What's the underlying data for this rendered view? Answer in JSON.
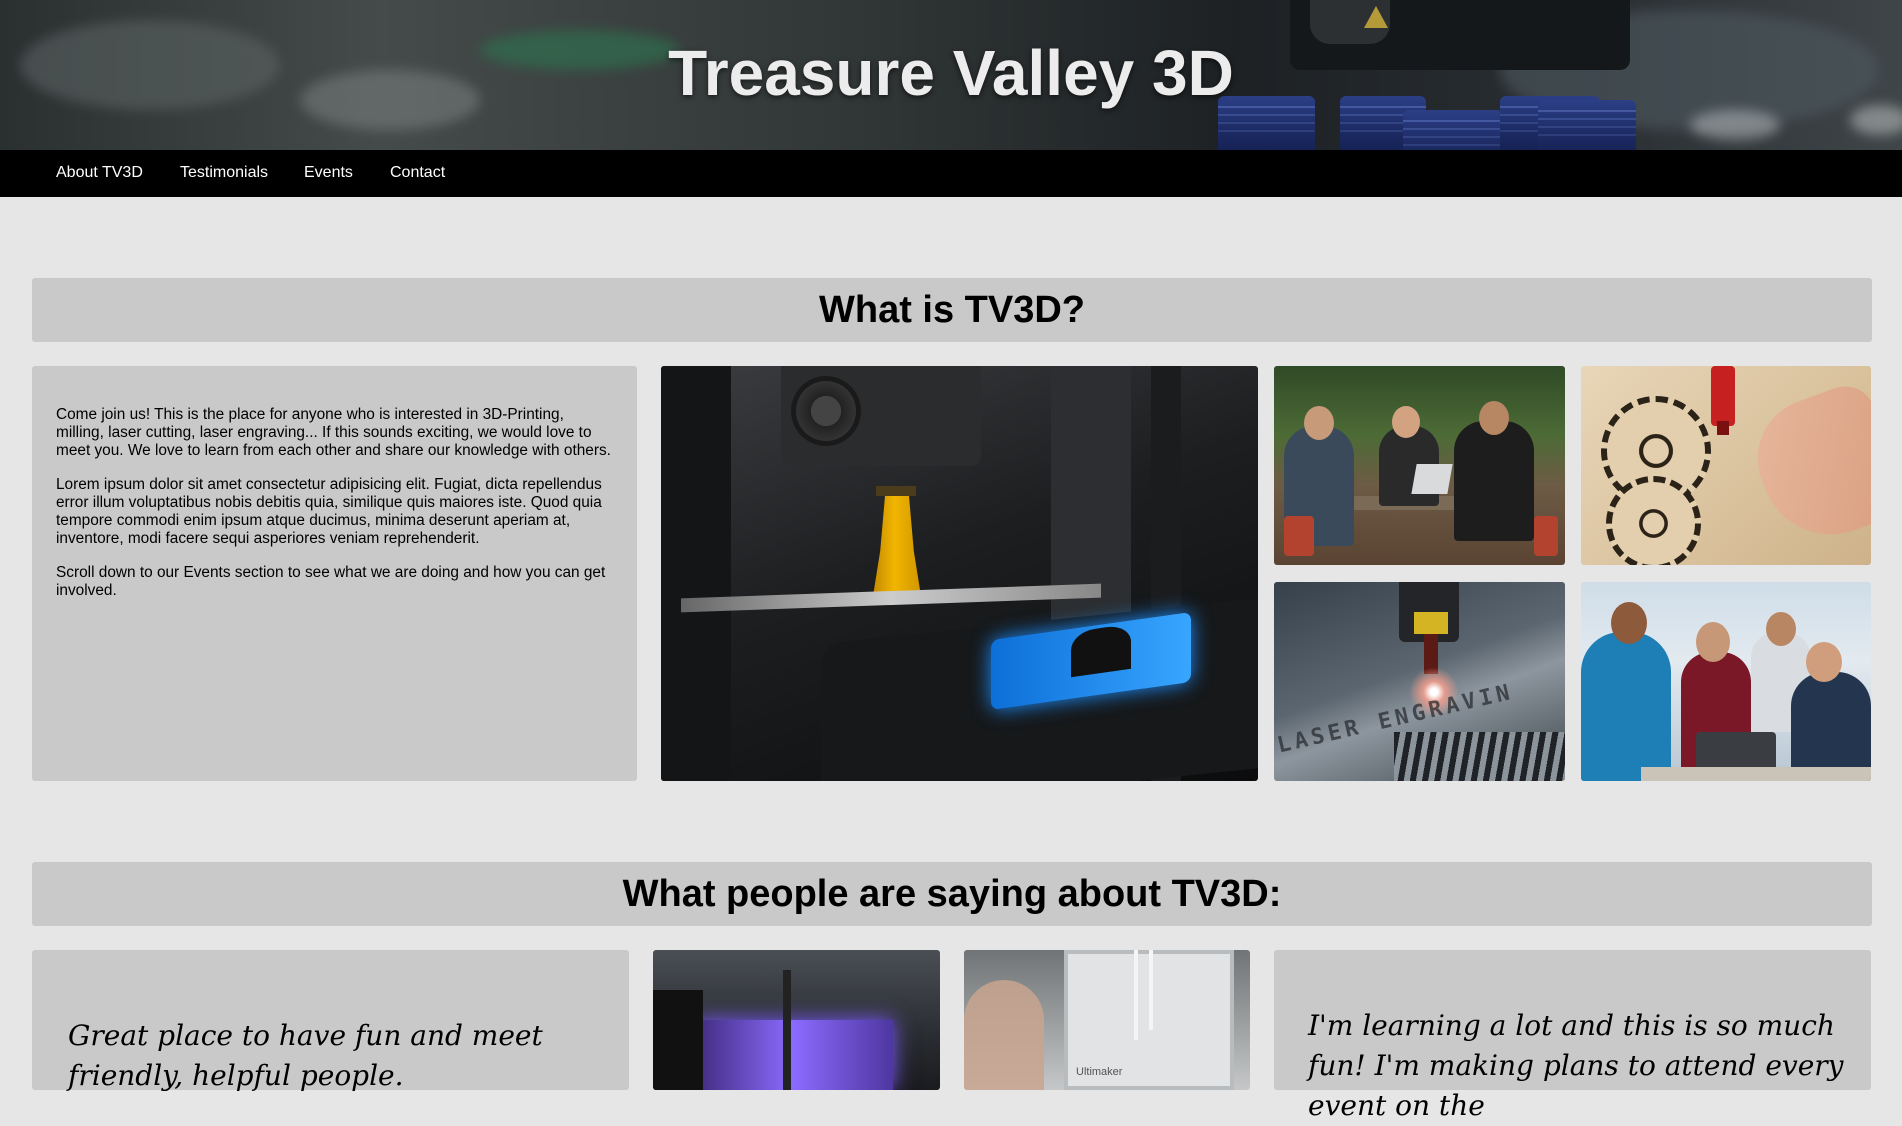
{
  "header": {
    "site_title": "Treasure Valley 3D"
  },
  "nav": {
    "items": [
      {
        "label": "About TV3D"
      },
      {
        "label": "Testimonials"
      },
      {
        "label": "Events"
      },
      {
        "label": "Contact"
      }
    ]
  },
  "about": {
    "heading": "What is TV3D?",
    "paragraphs": [
      "Come join us! This is the place for anyone who is interested in 3D-Printing, milling, laser cutting, laser engraving... If this sounds exciting, we would love to meet you. We love to learn from each other and share our knowledge with others.",
      "Lorem ipsum dolor sit amet consectetur adipisicing elit. Fugiat, dicta repellendus error illum voluptatibus nobis debitis quia, similique quis maiores iste. Quod quia tempore commodi enim ipsum atque ducimus, minima deserunt aperiam at, inventore, modi facere sequi asperiores veniam reprehenderit.",
      "Scroll down to our Events section to see what we are doing and how you can get involved."
    ],
    "laser_image_text": "LASER ENGRAVIN"
  },
  "testimonials": {
    "heading": "What people are saying about TV3D:",
    "quotes": [
      "Great place to have fun and meet friendly, helpful people.",
      "I'm learning a lot and this is so much fun! I'm making plans to attend every event on the"
    ],
    "printer_label": "Ultimaker"
  },
  "colors": {
    "page_background": "#e6e6e6",
    "panel": "#c9c9c9",
    "nav_background": "#000000",
    "nav_text": "#ffffff"
  }
}
